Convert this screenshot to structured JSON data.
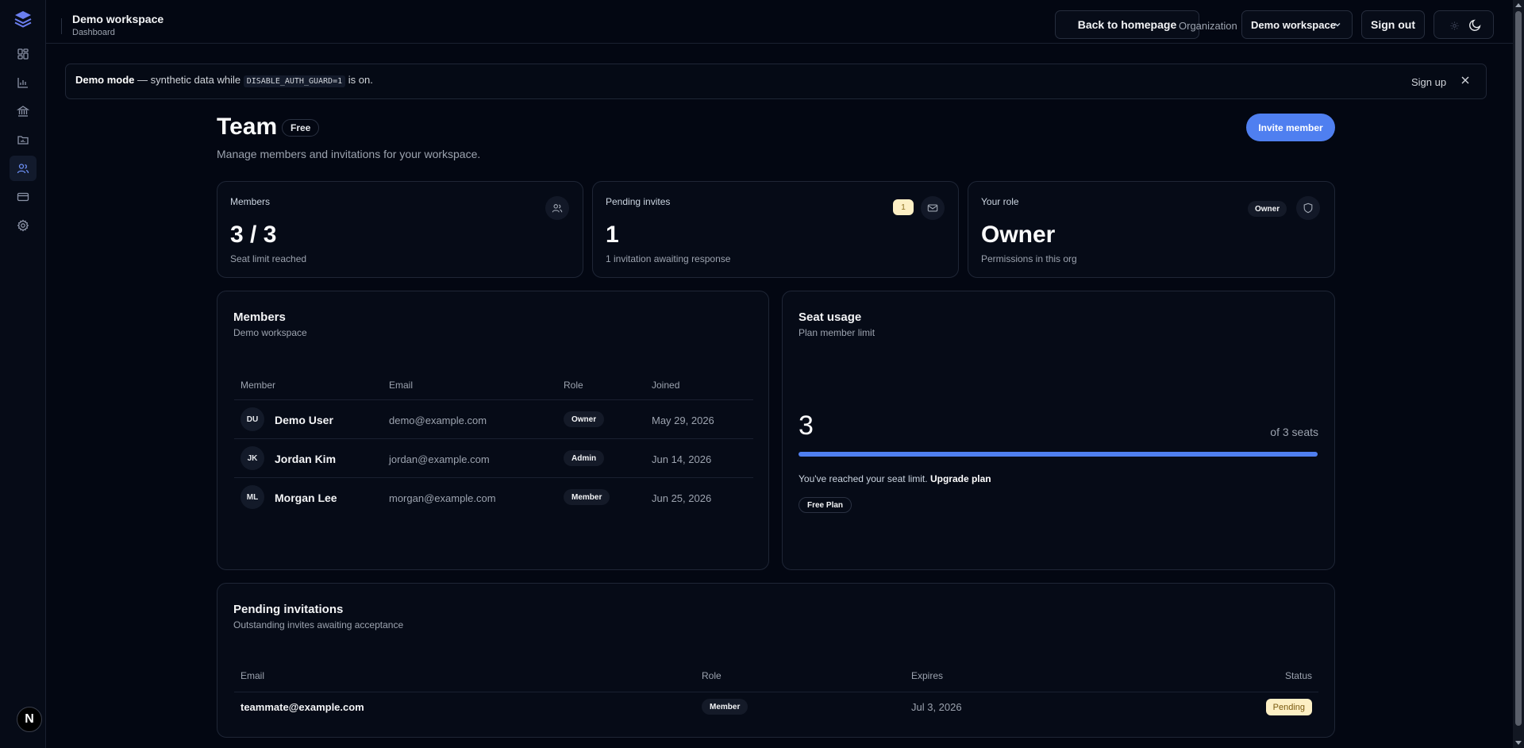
{
  "header": {
    "workspace_title": "Demo workspace",
    "workspace_subtitle": "Dashboard",
    "back_label": "Back to homepage",
    "org_label": "Organization",
    "org_selected": "Demo workspace",
    "sign_out_label": "Sign out"
  },
  "sidebar": {
    "items": [
      {
        "icon": "dashboard-icon",
        "active": false
      },
      {
        "icon": "bar-chart-icon",
        "active": false
      },
      {
        "icon": "bank-icon",
        "active": false
      },
      {
        "icon": "folder-chart-icon",
        "active": false
      },
      {
        "icon": "users-icon",
        "active": true
      },
      {
        "icon": "credit-card-icon",
        "active": false
      },
      {
        "icon": "gear-icon",
        "active": false
      }
    ],
    "user_initial": "N"
  },
  "banner": {
    "mode_label": "Demo mode",
    "text_before": " — synthetic data while ",
    "code": "DISABLE_AUTH_GUARD=1",
    "text_after": " is on.",
    "signup_label": "Sign up"
  },
  "page": {
    "title": "Team",
    "plan_badge": "Free",
    "subtitle": "Manage members and invitations for your workspace.",
    "invite_label": "Invite member"
  },
  "stats": {
    "members": {
      "label": "Members",
      "value": "3 / 3",
      "sub": "Seat limit reached"
    },
    "pending": {
      "label": "Pending invites",
      "badge": "1",
      "value": "1",
      "sub": "1 invitation awaiting response"
    },
    "role": {
      "label": "Your role",
      "badge": "Owner",
      "value": "Owner",
      "sub": "Permissions in this org"
    }
  },
  "members_card": {
    "title": "Members",
    "subtitle": "Demo workspace",
    "columns": [
      "Member",
      "Email",
      "Role",
      "Joined"
    ],
    "rows": [
      {
        "initials": "DU",
        "name": "Demo User",
        "email": "demo@example.com",
        "role": "Owner",
        "joined": "May 29, 2026"
      },
      {
        "initials": "JK",
        "name": "Jordan Kim",
        "email": "jordan@example.com",
        "role": "Admin",
        "joined": "Jun 14, 2026"
      },
      {
        "initials": "ML",
        "name": "Morgan Lee",
        "email": "morgan@example.com",
        "role": "Member",
        "joined": "Jun 25, 2026"
      }
    ]
  },
  "seat_usage": {
    "title": "Seat usage",
    "subtitle": "Plan member limit",
    "used": "3",
    "of_label": "of 3 seats",
    "fill_fraction": 1.0,
    "message": "You've reached your seat limit.",
    "upgrade_label": "Upgrade plan",
    "plan_pill": "Free Plan"
  },
  "invitations": {
    "title": "Pending invitations",
    "subtitle": "Outstanding invites awaiting acceptance",
    "columns": [
      "Email",
      "Role",
      "Expires",
      "Status"
    ],
    "rows": [
      {
        "email": "teammate@example.com",
        "role": "Member",
        "expires": "Jul 3, 2026",
        "status": "Pending"
      }
    ]
  },
  "colors": {
    "accent": "#4f7ff0",
    "background": "#030712",
    "pending": "#fcefc4"
  }
}
